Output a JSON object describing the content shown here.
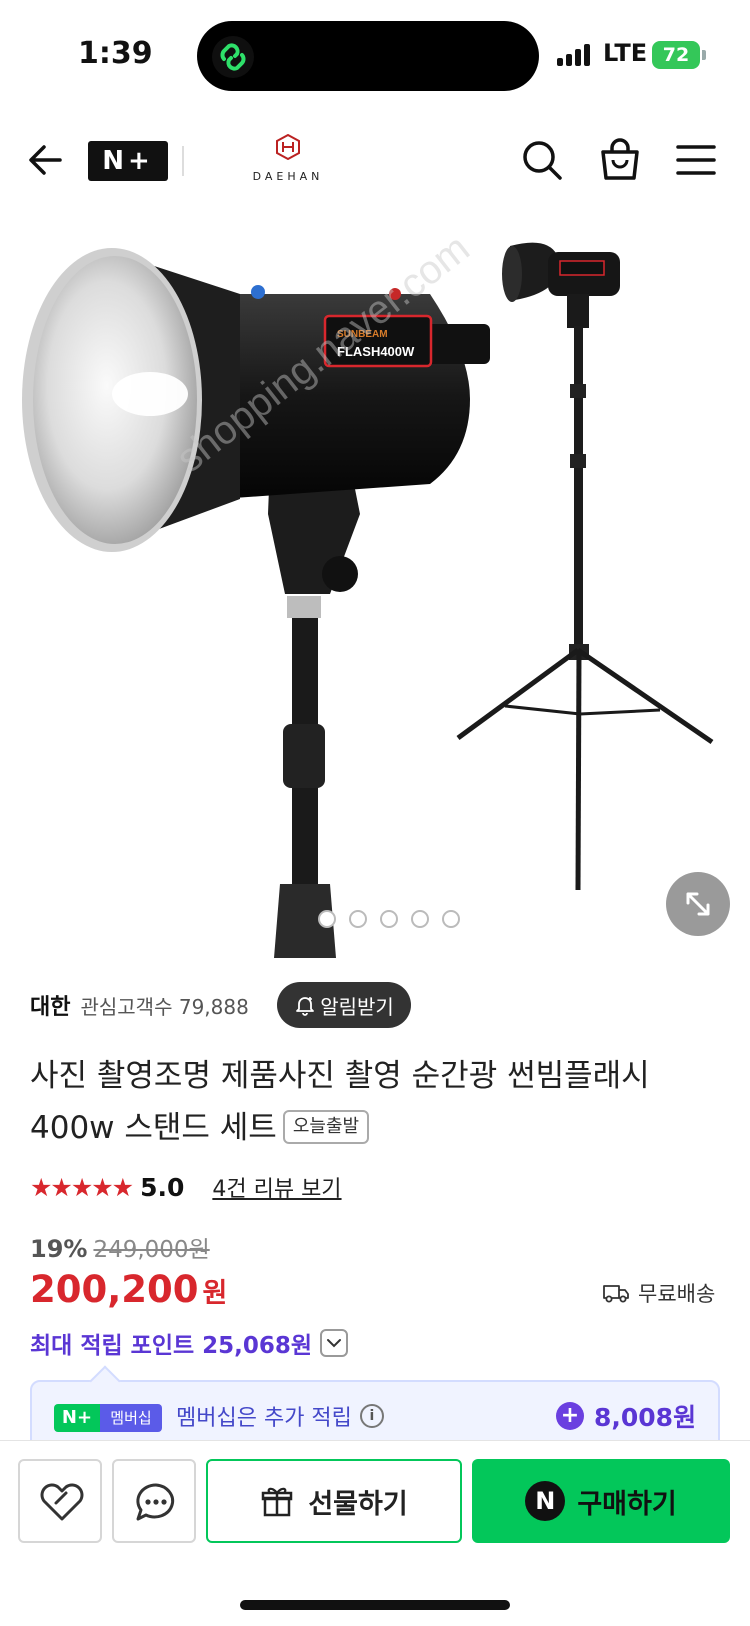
{
  "status_bar": {
    "time": "1:39",
    "network": "LTE",
    "battery": "72"
  },
  "header": {
    "platform_logo": "N+",
    "brand_name": "DAEHAN"
  },
  "image": {
    "product_label_1": "SUNBEAM",
    "product_label_2": "FLASH400W",
    "watermark": "shopping.naver.com"
  },
  "seller": {
    "name": "대한",
    "fans": "관심고객수 79,888",
    "alarm_label": "알림받기"
  },
  "product": {
    "title": "사진 촬영조명 제품사진 촬영 순간광 썬빔플래시 400w 스탠드 세트",
    "badge": "오늘출발"
  },
  "rating": {
    "stars": "★★★★★",
    "score": "5.0",
    "review_link": "4건 리뷰 보기"
  },
  "price": {
    "discount_rate": "19%",
    "original": "249,000원",
    "sale": "200,200",
    "unit": "원",
    "shipping": "무료배송"
  },
  "points": {
    "max_label": "최대 적립 포인트 25,068원"
  },
  "membership": {
    "badge_n": "N+",
    "badge_label": "멤버십",
    "text": "멤버십은 추가 적립",
    "extra": "8,008원"
  },
  "bottom_bar": {
    "gift_label": "선물하기",
    "buy_label": "구매하기",
    "buy_icon": "N"
  },
  "colors": {
    "naver_green": "#03c75a",
    "price_red": "#d8272d",
    "points_purple": "#5a36d4"
  }
}
